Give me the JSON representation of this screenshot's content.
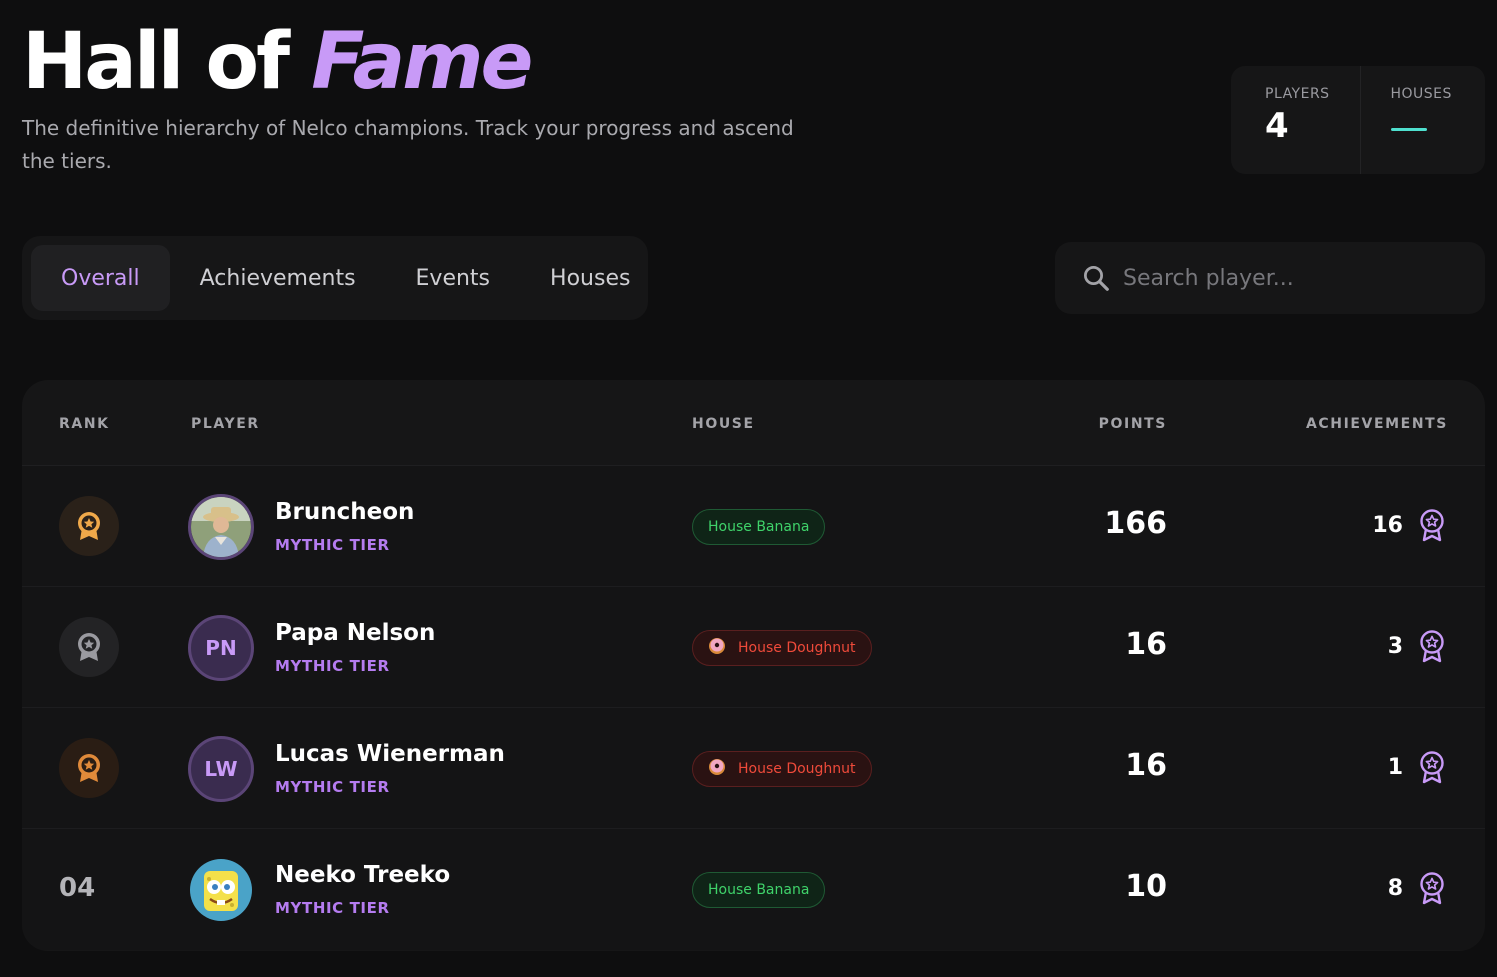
{
  "header": {
    "title_main": "Hall of",
    "title_accent": "Fame",
    "subtitle": "The definitive hierarchy of Nelco champions. Track your progress and ascend the tiers."
  },
  "stats": {
    "players_label": "PLAYERS",
    "players_value": "4",
    "houses_label": "HOUSES"
  },
  "tabs": [
    {
      "label": "Overall",
      "active": true
    },
    {
      "label": "Achievements",
      "active": false
    },
    {
      "label": "Events",
      "active": false
    },
    {
      "label": "Houses",
      "active": false
    }
  ],
  "search": {
    "placeholder": "Search player..."
  },
  "table": {
    "headers": {
      "rank": "RANK",
      "player": "PLAYER",
      "house": "HOUSE",
      "points": "POINTS",
      "achievements": "ACHIEVEMENTS"
    },
    "rows": [
      {
        "rank": "01",
        "medal": "gold",
        "name": "Bruncheon",
        "tier": "MYTHIC TIER",
        "avatar": "photo-man",
        "house": "House Banana",
        "house_type": "banana",
        "points": "166",
        "achievements": "16"
      },
      {
        "rank": "02",
        "medal": "silver",
        "name": "Papa Nelson",
        "tier": "MYTHIC TIER",
        "avatar_initials": "PN",
        "house": "House Doughnut",
        "house_type": "doughnut",
        "points": "16",
        "achievements": "3"
      },
      {
        "rank": "03",
        "medal": "bronze",
        "name": "Lucas Wienerman",
        "tier": "MYTHIC TIER",
        "avatar_initials": "LW",
        "house": "House Doughnut",
        "house_type": "doughnut",
        "points": "16",
        "achievements": "1"
      },
      {
        "rank": "04",
        "medal": "none",
        "name": "Neeko Treeko",
        "tier": "MYTHIC TIER",
        "avatar": "photo-sponge",
        "house": "House Banana",
        "house_type": "banana",
        "points": "10",
        "achievements": "8"
      }
    ]
  },
  "colors": {
    "accent": "#c89af7",
    "teal": "#4fe0cf",
    "gold": "#f0a94a",
    "silver": "#9a9aa0",
    "bronze": "#e08a3a"
  }
}
